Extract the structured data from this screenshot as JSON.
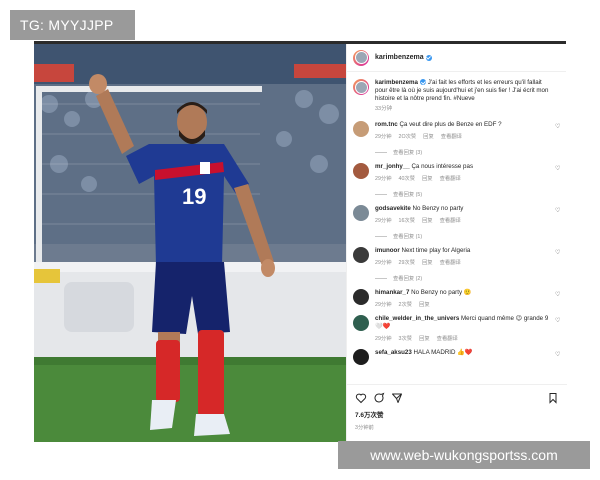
{
  "tag_label": "TG: MYYJJPP",
  "watermark": "www.web-wukongsportss.com",
  "photo": {
    "jersey_number": "19"
  },
  "post": {
    "username": "karimbenzema",
    "caption_username": "karimbenzema",
    "caption_text": "J'ai fait les efforts et les erreurs qu'il fallait pour être là où je suis aujourd'hui et j'en suis fier ! J'ai écrit mon histoire et la nôtre prend fin. #Nueve",
    "caption_time": "33分钟",
    "likes": "7.6万次赞",
    "time": "3分钟前"
  },
  "comments": [
    {
      "user": "rom.tnc",
      "text": "Ça veut dire plus de Benze en EDF ?",
      "time": "29分钟",
      "likes": "2O次赞",
      "reply_label": "回复",
      "translate_label": "查看翻译",
      "replies": "查看回复 (3)",
      "avatar_color": "#c69c77"
    },
    {
      "user": "mr_jonhy__",
      "text": "Ça nous intéresse pas",
      "time": "29分钟",
      "likes": "40次赞",
      "reply_label": "回复",
      "translate_label": "查看翻译",
      "replies": "查看回复 (5)",
      "avatar_color": "#a35a3f"
    },
    {
      "user": "godsavekite",
      "text": "No Benzy no party",
      "time": "29分钟",
      "likes": "16次赞",
      "reply_label": "回复",
      "translate_label": "查看翻译",
      "replies": "查看回复 (1)",
      "avatar_color": "#7b8a96"
    },
    {
      "user": "imunoor",
      "text": "Next time play for Algeria",
      "time": "29分钟",
      "likes": "29次赞",
      "reply_label": "回复",
      "translate_label": "查看翻译",
      "replies": "查看回复 (2)",
      "avatar_color": "#3a3a3a"
    },
    {
      "user": "himankar_7",
      "text": "No Benzy no party 🙂",
      "time": "29分钟",
      "likes": "2次赞",
      "reply_label": "回复",
      "translate_label": "",
      "replies": "",
      "avatar_color": "#2b2b2b"
    },
    {
      "user": "chile_welder_in_the_univers",
      "text": "Merci quand même 😉 grande 9 🤍❤️",
      "time": "29分钟",
      "likes": "3次赞",
      "reply_label": "回复",
      "translate_label": "查看翻译",
      "replies": "",
      "avatar_color": "#2f5f4f"
    },
    {
      "user": "sefa_aksu23",
      "text": "HALA MADRID 👍❤️",
      "time": "",
      "likes": "",
      "reply_label": "",
      "translate_label": "",
      "replies": "",
      "avatar_color": "#1d1d1d"
    }
  ],
  "icons": {
    "like": "heart-icon",
    "comment": "comment-icon",
    "share": "send-icon",
    "save": "bookmark-icon"
  },
  "colors": {
    "verified": "#3897f0",
    "france_blue": "#1f3a93",
    "sock_red": "#d62828"
  }
}
